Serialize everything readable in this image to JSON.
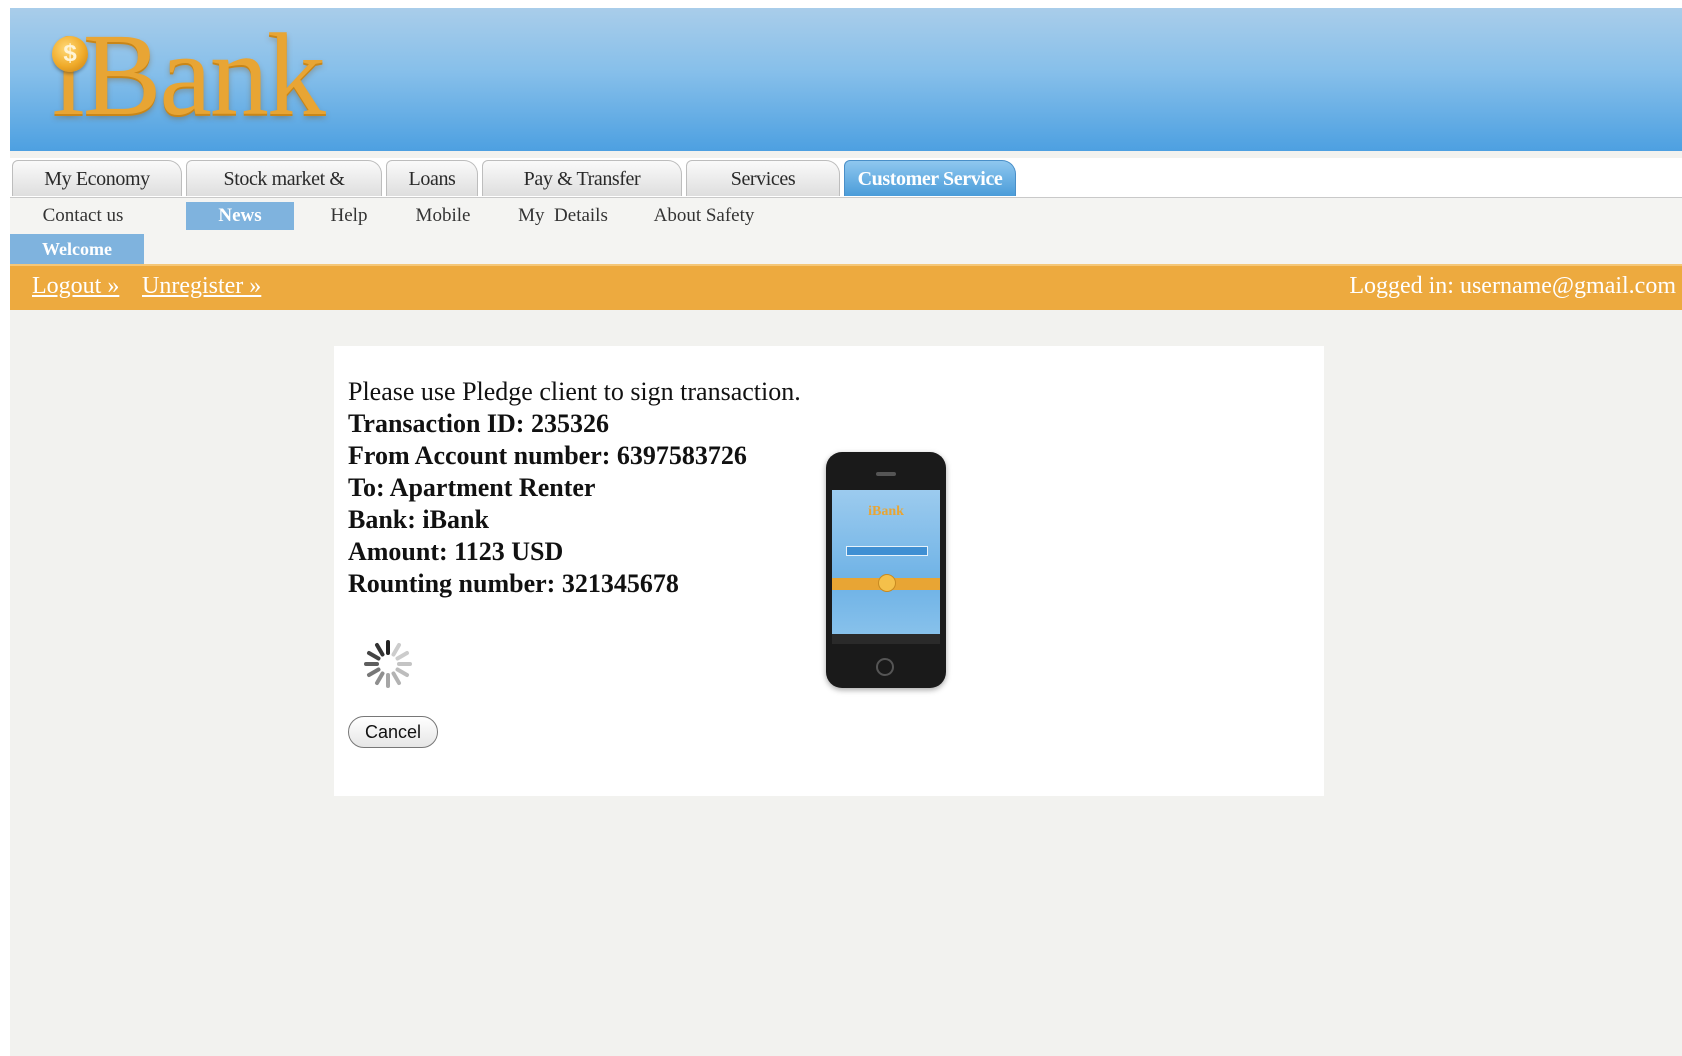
{
  "brand": {
    "logo_text": "iBank",
    "coin_symbol": "$",
    "colors": {
      "accent_orange": "#edaa3f",
      "header_blue": "#4da0e1",
      "active_tab_blue": "#7fb3de"
    }
  },
  "main_tabs": [
    {
      "label": "My Economy"
    },
    {
      "label": "Stock market & Financial"
    },
    {
      "label": "Loans"
    },
    {
      "label": "Pay & Transfer"
    },
    {
      "label": "Services"
    },
    {
      "label": "Customer Service",
      "active": true
    }
  ],
  "sub_nav": [
    {
      "label": "Contact us"
    },
    {
      "label": "News",
      "active": true
    },
    {
      "label": "Help"
    },
    {
      "label": "Mobile"
    },
    {
      "label": "My  Details"
    },
    {
      "label": "About Safety"
    }
  ],
  "welcome_label": "Welcome",
  "user_bar": {
    "logout": "Logout »",
    "unregister": "Unregister »",
    "logged_in": "Logged in: username@gmail.com"
  },
  "transaction": {
    "instruction": "Please use Pledge client to sign transaction.",
    "transaction_id": "Transaction ID: 235326",
    "from_account": "From Account number: 6397583726",
    "to": "To: Apartment Renter",
    "bank": "Bank: iBank",
    "amount": "Amount: 1123 USD",
    "routing": "Rounting number: 321345678"
  },
  "cancel_label": "Cancel",
  "icons": {
    "spinner": "loading-spinner-icon",
    "phone": "smartphone-image"
  }
}
